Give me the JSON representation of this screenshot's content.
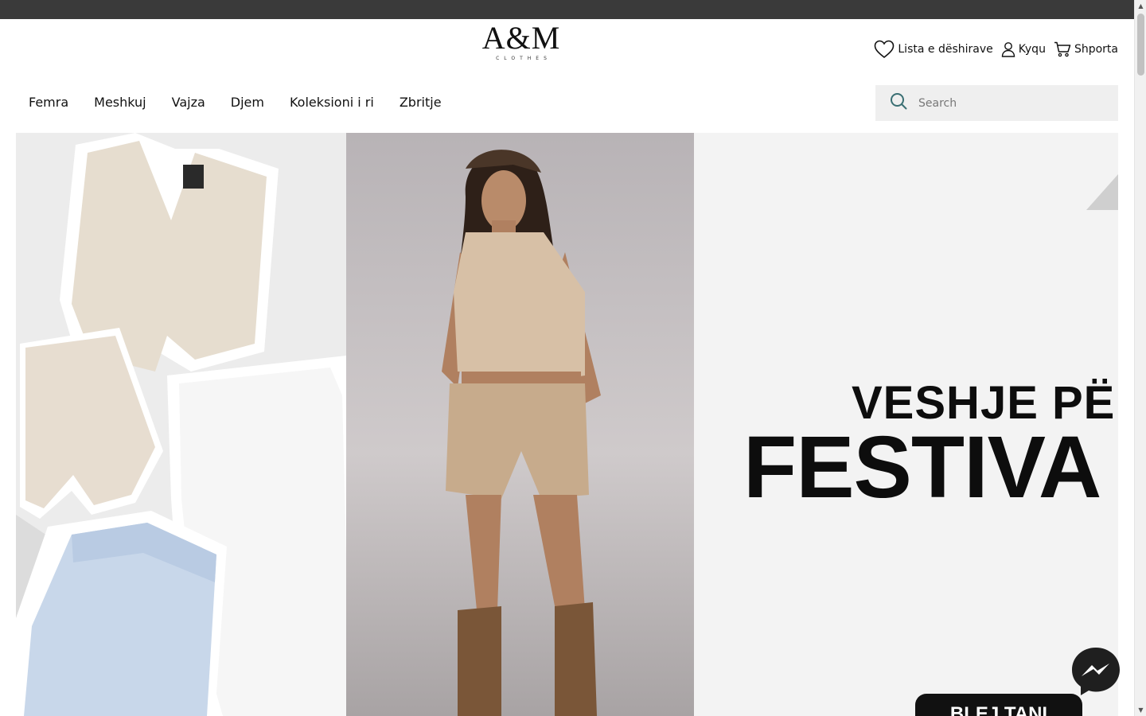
{
  "header": {
    "logo_mark": "A&M",
    "logo_sub": "CLOTHES",
    "wishlist_label": "Lista e dëshirave",
    "login_label": "Kyqu",
    "cart_label": "Shporta"
  },
  "nav": {
    "items": [
      "Femra",
      "Meshkuj",
      "Vajza",
      "Djem",
      "Koleksioni i ri",
      "Zbritje"
    ]
  },
  "search": {
    "placeholder": "Search"
  },
  "hero": {
    "headline_top": "VESHJE PË",
    "headline_main": "FESTIVA",
    "cta_label": "BLEJ TANI"
  },
  "icons": {
    "wishlist": "heart-icon",
    "login": "user-icon",
    "cart": "cart-icon",
    "search": "search-icon",
    "chat": "messenger-icon"
  },
  "colors": {
    "topbar": "#3a3a3a",
    "search_bg": "#efefef",
    "search_icon": "#3a6f73",
    "text": "#111111"
  }
}
